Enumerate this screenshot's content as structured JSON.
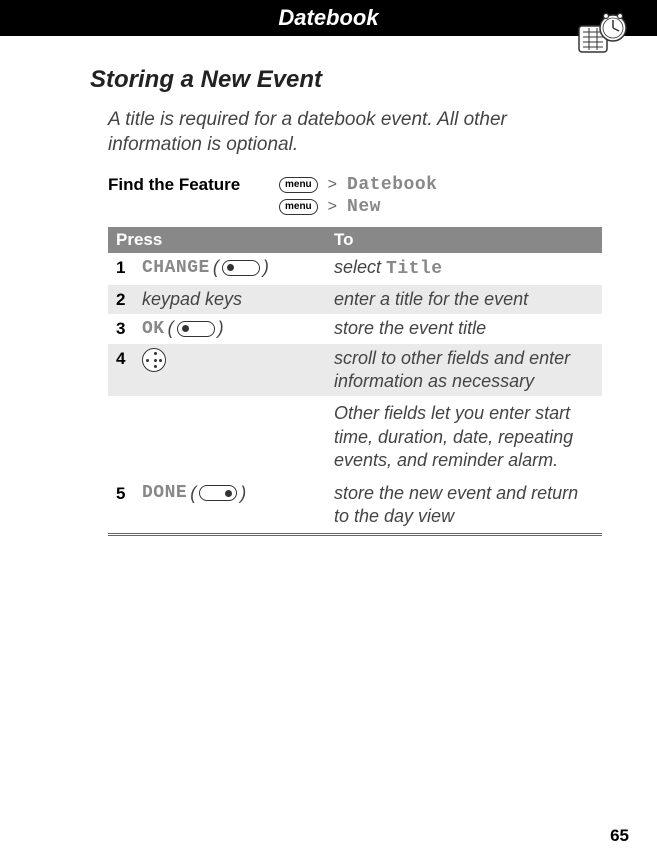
{
  "header": {
    "title": "Datebook"
  },
  "section": {
    "heading": "Storing a New Event"
  },
  "intro": "A title is required for a datebook event. All other information is optional.",
  "feature": {
    "label": "Find the Feature",
    "menu_btn": "menu",
    "path1": "Datebook",
    "path2": "New"
  },
  "table": {
    "head_press": "Press",
    "head_to": "To",
    "rows": [
      {
        "num": "1",
        "press_label": "CHANGE",
        "press_type": "softkey-left",
        "to_pre": "select ",
        "to_mono": "Title"
      },
      {
        "num": "2",
        "press_text": "keypad keys",
        "to_text": "enter a title for the event"
      },
      {
        "num": "3",
        "press_label": "OK",
        "press_type": "softkey-left",
        "to_text": "store the event title"
      },
      {
        "num": "4",
        "press_type": "nav",
        "to_text": "scroll to other fields and enter information as necessary"
      },
      {
        "num": "5",
        "press_label": "DONE",
        "press_type": "softkey-right",
        "to_text": "store the new event and return to the day view"
      }
    ],
    "extra": "Other fields let you enter start time, duration, date, repeating events, and reminder alarm."
  },
  "page": "65"
}
